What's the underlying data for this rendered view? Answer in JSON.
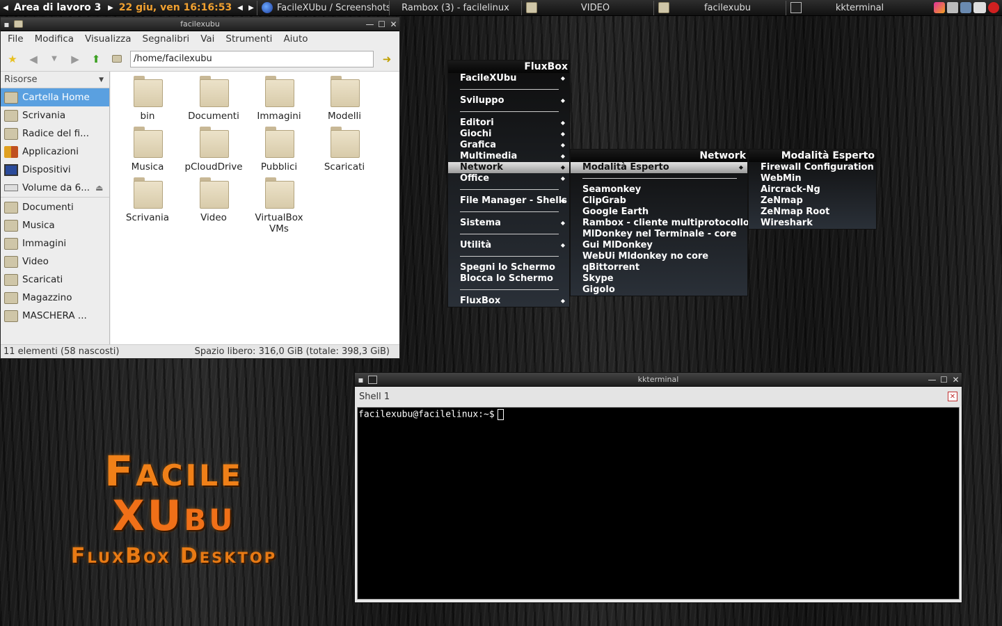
{
  "toolbar": {
    "workspace": "Area di lavoro 3",
    "clock": "22 giu, ven 16:16:53",
    "tasks": [
      {
        "label": "FacileXUbu / Screenshots",
        "icon": "firefox-icon"
      },
      {
        "label": "Rambox (3) - facilelinux",
        "icon": "none"
      },
      {
        "label": "VIDEO",
        "icon": "folder-icon"
      },
      {
        "label": "facilexubu",
        "icon": "folder-icon"
      },
      {
        "label": "kkterminal",
        "icon": "terminal-icon"
      }
    ]
  },
  "filemanager": {
    "title": "facilexubu",
    "menu": [
      "File",
      "Modifica",
      "Visualizza",
      "Segnalibri",
      "Vai",
      "Strumenti",
      "Aiuto"
    ],
    "location": "/home/facilexubu",
    "sidebar_header": "Risorse",
    "sidebar": [
      {
        "label": "Cartella Home"
      },
      {
        "label": "Scrivania"
      },
      {
        "label": "Radice del fi..."
      },
      {
        "label": "Applicazioni"
      },
      {
        "label": "Dispositivi"
      },
      {
        "label": "Volume da 6..."
      },
      {
        "label": "Documenti"
      },
      {
        "label": "Musica"
      },
      {
        "label": "Immagini"
      },
      {
        "label": "Video"
      },
      {
        "label": "Scaricati"
      },
      {
        "label": "Magazzino"
      },
      {
        "label": "MASCHERA ..."
      }
    ],
    "files": [
      "bin",
      "Documenti",
      "Immagini",
      "Modelli",
      "Musica",
      "pCloudDrive",
      "Pubblici",
      "Scaricati",
      "Scrivania",
      "Video",
      "VirtualBox VMs"
    ],
    "status_left": "11 elementi (58 nascosti)",
    "status_right": "Spazio libero: 316,0 GiB (totale: 398,3 GiB)"
  },
  "menus": {
    "root_title": "FluxBox",
    "root": [
      "FacileXUbu",
      "Sviluppo",
      "Editori",
      "Giochi",
      "Grafica",
      "Multimedia",
      "Network",
      "Office",
      "File Manager - Shells",
      "Sistema",
      "Utilità",
      "Spegni lo Schermo",
      "Blocca lo Schermo",
      "FluxBox"
    ],
    "network_title": "Network",
    "network": [
      "Modalità Esperto",
      "Seamonkey",
      "ClipGrab",
      "Google Earth",
      "Rambox - cliente multiprotocollo",
      "MlDonkey nel Terminale - core",
      "Gui MlDonkey",
      "WebUi Mldonkey no core",
      "qBittorrent",
      "Skype",
      "Gigolo"
    ],
    "expert_title": "Modalità Esperto",
    "expert": [
      "Firewall Configuration",
      "WebMin",
      "Aircrack-Ng",
      "ZeNmap",
      "ZeNmap Root",
      "Wireshark"
    ]
  },
  "terminal": {
    "title": "kkterminal",
    "tab": "Shell 1",
    "prompt": "facilexubu@facilelinux:~$"
  },
  "logo": {
    "line1": "Facile",
    "line2": "XUbu",
    "line3": "FluxBox Desktop"
  }
}
